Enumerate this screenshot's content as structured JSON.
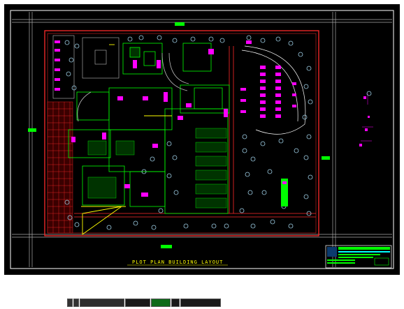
{
  "canvas": {
    "background": "#000000",
    "colors": {
      "boundary": "#ff2a2a",
      "building": "#00ff00",
      "magenta": "#ff00ff",
      "cyan": "#00ffff",
      "yellow": "#ffff00",
      "trees": "#9ecfe6",
      "white": "#ffffff"
    }
  },
  "labels": {
    "drawing_title": "PLOT PLAN BUILDING LAYOUT",
    "north_tag": "ROAD",
    "south_tag": "ROAD",
    "west_tag": "ROAD",
    "east_tag": "ROAD"
  },
  "title_block": {
    "project": "GENERAL HOSPITAL",
    "sheet": "A-1"
  },
  "bottom_tabs": [
    "",
    "",
    "",
    "",
    "",
    "",
    "",
    ""
  ]
}
